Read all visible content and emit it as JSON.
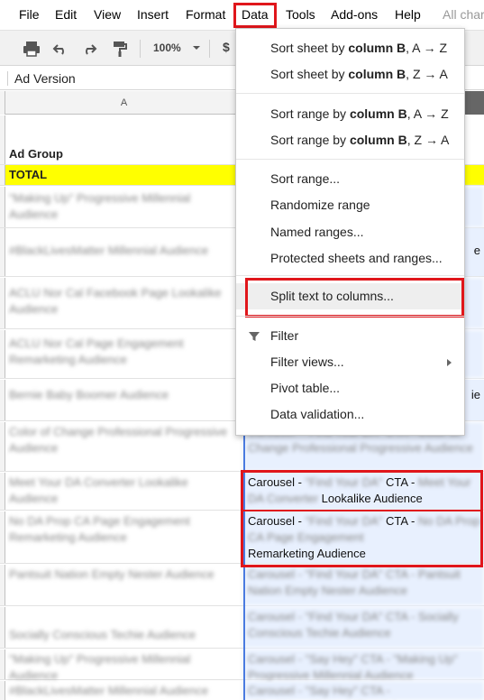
{
  "menubar": {
    "items": [
      "File",
      "Edit",
      "View",
      "Insert",
      "Format",
      "Data",
      "Tools",
      "Add-ons",
      "Help",
      "All char"
    ],
    "highlighted": "Data"
  },
  "toolbar": {
    "icons": [
      "print-icon",
      "undo-icon",
      "redo-icon",
      "paint-format-icon"
    ],
    "zoom": "100%",
    "currency": "$"
  },
  "formula_bar": {
    "value": "Ad Version"
  },
  "columns": {
    "a": "A"
  },
  "sheet": {
    "header_row": {
      "a": "Ad Group"
    },
    "total_row": {
      "a": "TOTAL"
    },
    "rows": [
      {
        "a": "\"Making Up\" Progressive Millennial Audience",
        "b": ""
      },
      {
        "a": "#BlackLivesMatter Millennial Audience",
        "b": "e"
      },
      {
        "a": "ACLU Nor Cal Facebook Page Lookalike Audience",
        "b": ""
      },
      {
        "a": "ACLU Nor Cal Page Engagement Remarketing Audience",
        "b": ""
      },
      {
        "a": "Bernie Baby Boomer Audience",
        "b": "ie"
      },
      {
        "a": "Color of Change Professional Progressive Audience",
        "b": "Carousel - \"Find Your DA\" CTA - Color of Change Professional Progressive Audience"
      },
      {
        "a": "Meet Your DA Converter Lookalike Audience",
        "b_parts": [
          "Carousel - ",
          "\"Find Your DA\"",
          " CTA - ",
          "Meet Your DA Converter",
          " Lookalike Audience"
        ]
      },
      {
        "a": "No DA Prop CA Page Engagement Remarketing Audience",
        "b_parts": [
          "Carousel - ",
          "\"Find Your DA\"",
          " CTA - ",
          "No DA Prop CA Page Engagement",
          "Remarketing Audience"
        ]
      },
      {
        "a": "Pantsuit Nation Empty Nester Audience",
        "b": "Carousel - \"Find Your DA\" CTA - Pantsuit Nation Empty Nester Audience"
      },
      {
        "a": "Socially Conscious Techie Audience",
        "b": "Carousel - \"Find Your DA\" CTA - Socially Conscious Techie Audience"
      },
      {
        "a": "\"Making Up\" Progressive Millennial Audience",
        "b": "Carousel - \"Say Hey\" CTA - \"Making Up\" Progressive Millennial Audience"
      },
      {
        "a": "#BlackLivesMatter Millennial Audience",
        "b": "Carousel - \"Say Hey\" CTA - #BlackLivesMatter Millennial"
      }
    ]
  },
  "data_menu": {
    "items": [
      {
        "pre": "Sort sheet by ",
        "bold": "column B",
        "post": ", A → Z"
      },
      {
        "pre": "Sort sheet by ",
        "bold": "column B",
        "post": ", Z → A"
      },
      {
        "pre": "Sort range by ",
        "bold": "column B",
        "post": ", A → Z"
      },
      {
        "pre": "Sort range by ",
        "bold": "column B",
        "post": ", Z → A"
      },
      {
        "label": "Sort range..."
      },
      {
        "label": "Randomize range"
      },
      {
        "label": "Named ranges..."
      },
      {
        "label": "Protected sheets and ranges..."
      },
      {
        "label": "Split text to columns..."
      },
      {
        "label": "Filter"
      },
      {
        "label": "Filter views..."
      },
      {
        "label": "Pivot table..."
      },
      {
        "label": "Data validation..."
      }
    ]
  },
  "colors": {
    "highlight_red": "#e0161b",
    "total_yellow": "#ffff00",
    "selection_blue": "#e8f0fe"
  }
}
